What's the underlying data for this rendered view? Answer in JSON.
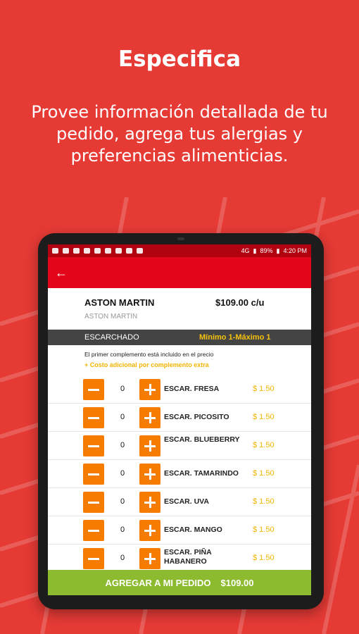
{
  "headline": "Especifica",
  "subtitle": "Provee información detallada de tu pedido, agrega tus alergias y preferencias alimenticias.",
  "status_bar": {
    "battery": "89%",
    "time": "4:20 PM",
    "network": "4G"
  },
  "product": {
    "name": "ASTON MARTIN",
    "subname": "ASTON MARTIN",
    "price": "$109.00  c/u"
  },
  "section": {
    "title": "ESCARCHADO",
    "limits": "Mínimo 1-Máximo 1"
  },
  "notes": {
    "included": "El primer complemento está incluido en el precio",
    "extra": "+ Costo adicional por complemento extra"
  },
  "items": [
    {
      "qty": "0",
      "name": "ESCAR. FRESA",
      "price": "$ 1.50"
    },
    {
      "qty": "0",
      "name": "ESCAR. PICOSITO",
      "price": "$ 1.50"
    },
    {
      "qty": "0",
      "name": "ESCAR.  BLUEBERRY",
      "price": "$ 1.50"
    },
    {
      "qty": "0",
      "name": "ESCAR. TAMARINDO",
      "price": "$ 1.50"
    },
    {
      "qty": "0",
      "name": "ESCAR. UVA",
      "price": "$ 1.50"
    },
    {
      "qty": "0",
      "name": "ESCAR. MANGO",
      "price": "$ 1.50"
    },
    {
      "qty": "0",
      "name": "ESCAR.  PIÑA HABANERO",
      "price": "$ 1.50"
    }
  ],
  "footer": {
    "label": "AGREGAR A MI PEDIDO",
    "total": "$109.00"
  },
  "colors": {
    "background": "#e63a35",
    "appbar": "#e3061a",
    "button": "#f57c00",
    "price": "#f4b400",
    "footer": "#8cbb2f"
  }
}
